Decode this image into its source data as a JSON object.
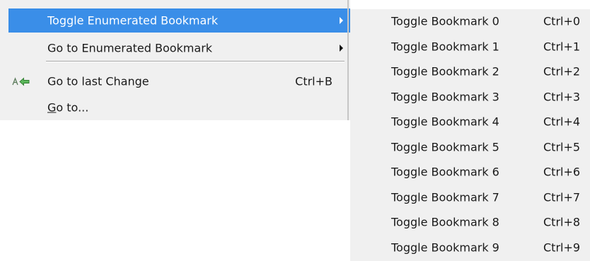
{
  "main_menu": {
    "items": [
      {
        "label": "Toggle Enumerated Bookmark",
        "has_submenu": true,
        "highlighted": true
      },
      {
        "label": "Go to Enumerated Bookmark",
        "has_submenu": true
      },
      {
        "label": "Go to last Change",
        "shortcut": "Ctrl+B",
        "icon": "go-to-last-change-icon"
      },
      {
        "label_mnemonic": "G",
        "label_rest": "o to...",
        "mnemonic_underlined": true
      }
    ]
  },
  "submenu": {
    "items": [
      {
        "label": "Toggle Bookmark 0",
        "shortcut": "Ctrl+0"
      },
      {
        "label": "Toggle Bookmark 1",
        "shortcut": "Ctrl+1"
      },
      {
        "label": "Toggle Bookmark 2",
        "shortcut": "Ctrl+2"
      },
      {
        "label": "Toggle Bookmark 3",
        "shortcut": "Ctrl+3"
      },
      {
        "label": "Toggle Bookmark 4",
        "shortcut": "Ctrl+4"
      },
      {
        "label": "Toggle Bookmark 5",
        "shortcut": "Ctrl+5"
      },
      {
        "label": "Toggle Bookmark 6",
        "shortcut": "Ctrl+6"
      },
      {
        "label": "Toggle Bookmark 7",
        "shortcut": "Ctrl+7"
      },
      {
        "label": "Toggle Bookmark 8",
        "shortcut": "Ctrl+8"
      },
      {
        "label": "Toggle Bookmark 9",
        "shortcut": "Ctrl+9"
      }
    ]
  },
  "colors": {
    "menu_background": "#f0f0f0",
    "highlight_background": "#3a8ee8",
    "highlight_text": "#ffffff",
    "text": "#1a1a1a"
  }
}
